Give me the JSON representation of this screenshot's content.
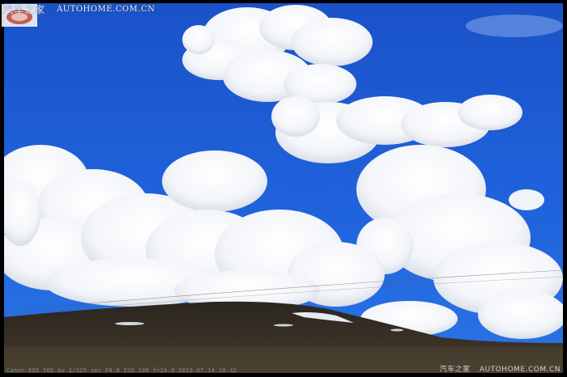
{
  "watermark_top": {
    "site_cn": "汽车之家",
    "site_url": "AUTOHOME.COM.CN"
  },
  "watermark_bottom": {
    "site_cn": "汽车之家",
    "site_url": "AUTOHOME.COM.CN"
  },
  "exif": "Canon EOS 50D  Av 1/125 sec  F8.0  ISO 100  f=24.0  2013.07.14 10:42",
  "colors": {
    "sky": "#1d5fd6",
    "cloud": "#f4f6fa",
    "hill": "#2a2520",
    "frame": "#000000"
  }
}
